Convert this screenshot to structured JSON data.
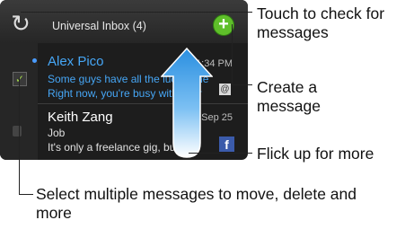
{
  "header": {
    "title": "Universal Inbox (4)"
  },
  "messages": [
    {
      "sender": "Alex Pico",
      "time": "1:34 PM",
      "line1": "Some guys have all the luck... me",
      "line2": "Right now, you're busy with your",
      "unread": true
    },
    {
      "sender": "Keith Zang",
      "time": "Sep 25",
      "line1": "Job",
      "line2": "It's only a freelance gig, but it's",
      "unread": false
    }
  ],
  "callouts": {
    "check": "Touch to check for messages",
    "create": "Create a message",
    "flick": "Flick up for more",
    "select": "Select multiple messages to move, delete and more"
  },
  "colors": {
    "accent_blue": "#46a6f5",
    "compose_green": "#5fbf2a",
    "facebook_blue": "#3b5bab"
  },
  "icons": {
    "sync": "sync-icon",
    "compose": "plus-icon",
    "facebook": "facebook-icon",
    "attachment": "at-icon",
    "flick": "up-arrow-icon"
  }
}
